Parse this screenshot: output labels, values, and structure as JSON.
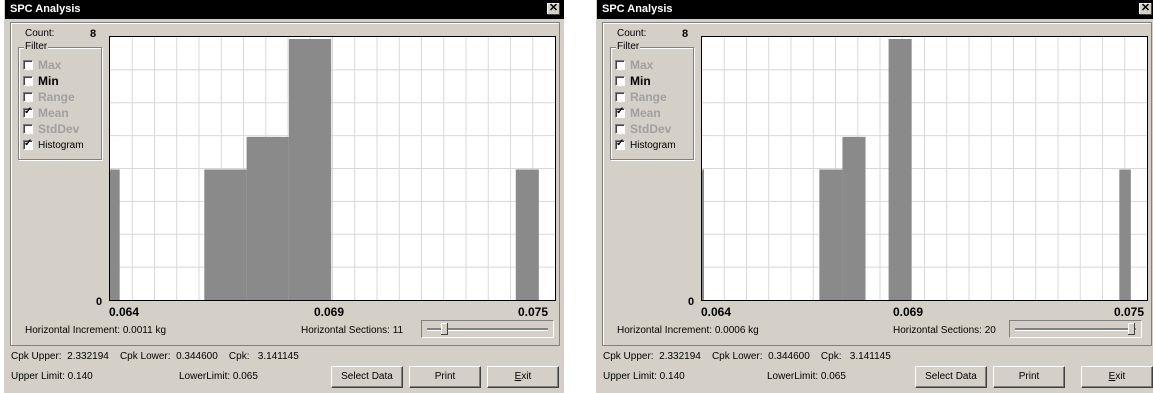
{
  "windows": [
    {
      "title": "SPC Analysis",
      "close_glyph": "✕",
      "count_label": "Count:",
      "count_max": "8",
      "count_min": "0",
      "filter_legend": "Filter",
      "filters": [
        {
          "label": "Max",
          "checked": false,
          "enabled": false
        },
        {
          "label": "Min",
          "checked": false,
          "enabled": true
        },
        {
          "label": "Range",
          "checked": false,
          "enabled": false
        },
        {
          "label": "Mean",
          "checked": true,
          "enabled": false
        },
        {
          "label": "StdDev",
          "checked": false,
          "enabled": false
        },
        {
          "label": "Histogram",
          "checked": true,
          "enabled": true
        }
      ],
      "x_ticks": [
        "0.064",
        "0.069",
        "0.075"
      ],
      "horizontal_increment": "Horizontal Increment: 0.0011 kg",
      "horizontal_sections": "Horizontal Sections: 11",
      "slider_fraction": 0.13,
      "stats": "Cpk Upper:  2.332194    Cpk Lower:  0.344600    Cpk:   3.141145",
      "upper_limit": "Upper Limit: 0.140",
      "lower_limit": "LowerLimit:  0.065",
      "buttons": {
        "select": "Select Data",
        "print": "Print",
        "exit": "Exit"
      },
      "chart_data": {
        "type": "bar",
        "x_range": [
          0.064,
          0.075
        ],
        "ylim": [
          0,
          8
        ],
        "bins": [
          {
            "start": 0.0637,
            "end": 0.0642,
            "value": 4
          },
          {
            "start": 0.0664,
            "end": 0.0675,
            "value": 4
          },
          {
            "start": 0.0675,
            "end": 0.0686,
            "value": 5
          },
          {
            "start": 0.0686,
            "end": 0.0697,
            "value": 8
          },
          {
            "start": 0.0745,
            "end": 0.0751,
            "value": 4
          }
        ],
        "grid": true
      }
    },
    {
      "title": "SPC Analysis",
      "close_glyph": "✕",
      "count_label": "Count:",
      "count_max": "8",
      "count_min": "0",
      "filter_legend": "Filter",
      "filters": [
        {
          "label": "Max",
          "checked": false,
          "enabled": false
        },
        {
          "label": "Min",
          "checked": false,
          "enabled": true
        },
        {
          "label": "Range",
          "checked": false,
          "enabled": false
        },
        {
          "label": "Mean",
          "checked": true,
          "enabled": false
        },
        {
          "label": "StdDev",
          "checked": false,
          "enabled": false
        },
        {
          "label": "Histogram",
          "checked": true,
          "enabled": true
        }
      ],
      "x_ticks": [
        "0.064",
        "0.069",
        "0.075"
      ],
      "horizontal_increment": "Horizontal Increment: 0.0006 kg",
      "horizontal_sections": "Horizontal Sections: 20",
      "slider_fraction": 0.97,
      "stats": "Cpk Upper:  2.332194    Cpk Lower:  0.344600    Cpk:   3.141145",
      "upper_limit": "Upper Limit: 0.140",
      "lower_limit": "LowerLimit:  0.065",
      "buttons": {
        "select": "Select Data",
        "print": "Print",
        "exit": "Exit"
      },
      "chart_data": {
        "type": "bar",
        "x_range": [
          0.064,
          0.075
        ],
        "ylim": [
          0,
          8
        ],
        "bins": [
          {
            "start": 0.0637,
            "end": 0.064,
            "value": 4
          },
          {
            "start": 0.067,
            "end": 0.0676,
            "value": 4
          },
          {
            "start": 0.0676,
            "end": 0.0682,
            "value": 5
          },
          {
            "start": 0.0688,
            "end": 0.0694,
            "value": 8
          },
          {
            "start": 0.0748,
            "end": 0.0751,
            "value": 4
          }
        ],
        "grid": true
      }
    }
  ]
}
